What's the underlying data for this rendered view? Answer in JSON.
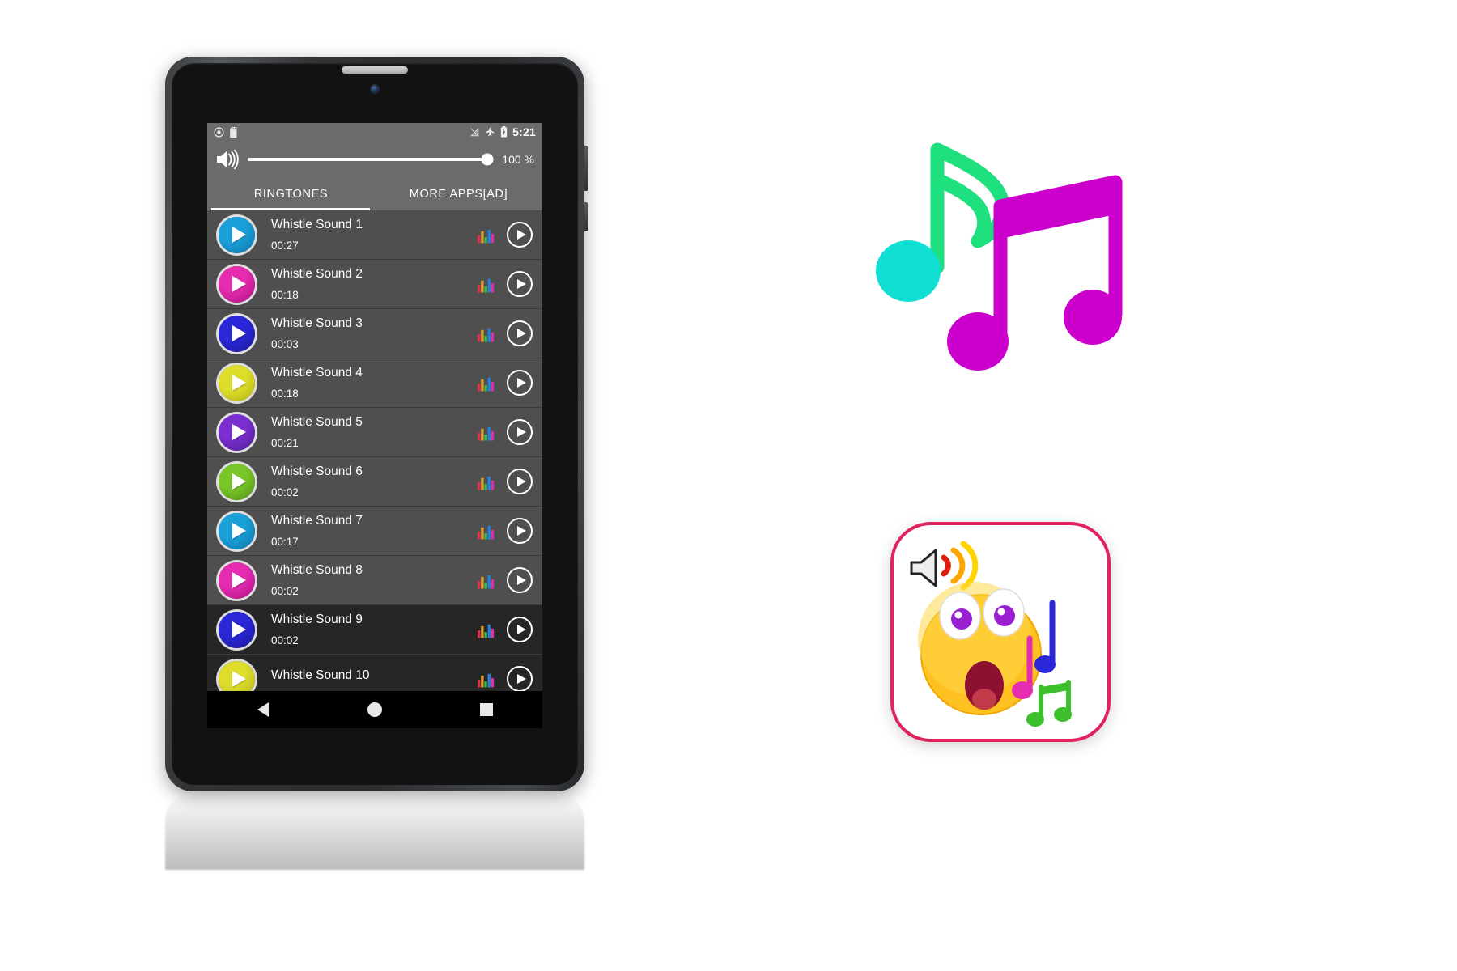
{
  "device": {
    "name": "android-tablet",
    "speaker": "earpiece-speaker",
    "camera": "front-camera"
  },
  "status_bar": {
    "time": "5:21",
    "left_icons": [
      "recording-icon",
      "sd-card-icon"
    ],
    "right_icons": [
      "no-sim-icon",
      "airplane-mode-icon",
      "battery-icon"
    ]
  },
  "volume": {
    "icon": "speaker-volume-icon",
    "percent_label": "100 %",
    "value": 100
  },
  "tabs": [
    {
      "label": "RINGTONES",
      "active": true
    },
    {
      "label": "MORE APPS[AD]",
      "active": false
    }
  ],
  "ringtones": [
    {
      "title": "Whistle Sound 1",
      "duration": "00:27",
      "color": "#1b9fd8",
      "color2": "#0c74a8",
      "row_shade": "light"
    },
    {
      "title": "Whistle Sound 2",
      "duration": "00:18",
      "color": "#e52bb0",
      "color2": "#a8117f",
      "row_shade": "light"
    },
    {
      "title": "Whistle Sound 3",
      "duration": "00:03",
      "color": "#2a27d8",
      "color2": "#1a1794",
      "row_shade": "light"
    },
    {
      "title": "Whistle Sound 4",
      "duration": "00:18",
      "color": "#dede2a",
      "color2": "#b0b017",
      "row_shade": "light"
    },
    {
      "title": "Whistle Sound 5",
      "duration": "00:21",
      "color": "#7b2fd0",
      "color2": "#4d1a8c",
      "row_shade": "light"
    },
    {
      "title": "Whistle Sound 6",
      "duration": "00:02",
      "color": "#7ac62a",
      "color2": "#4f8e14",
      "row_shade": "light"
    },
    {
      "title": "Whistle Sound 7",
      "duration": "00:17",
      "color": "#1b9fd8",
      "color2": "#0c74a8",
      "row_shade": "light"
    },
    {
      "title": "Whistle Sound 8",
      "duration": "00:02",
      "color": "#e52bb0",
      "color2": "#a8117f",
      "row_shade": "light"
    },
    {
      "title": "Whistle Sound 9",
      "duration": "00:02",
      "color": "#2a27d8",
      "color2": "#1a1794",
      "row_shade": "dark"
    },
    {
      "title": "Whistle Sound 10",
      "duration": "",
      "color": "#dede2a",
      "color2": "#b0b017",
      "row_shade": "dark"
    }
  ],
  "row_icons": {
    "equalizer": "equalizer-icon",
    "play": "play-circle-icon"
  },
  "nav_bar": {
    "back": "back-triangle-icon",
    "home": "home-circle-icon",
    "recents": "recents-square-icon"
  },
  "artwork": {
    "music_notes": {
      "name": "music-notes-illustration",
      "eighth_note_stem_color": "#1fe07f",
      "eighth_note_head_color": "#11dfd4",
      "beamed_notes_color": "#cc00cc"
    },
    "app_icon": {
      "name": "whistle-sounds-app-icon",
      "border_color": "#e0245e",
      "face_color": "#ffd233",
      "speaker_wave_color": "#f03010",
      "note_colors": [
        "#2a27d8",
        "#e52bb0",
        "#3bbf2a"
      ]
    }
  }
}
